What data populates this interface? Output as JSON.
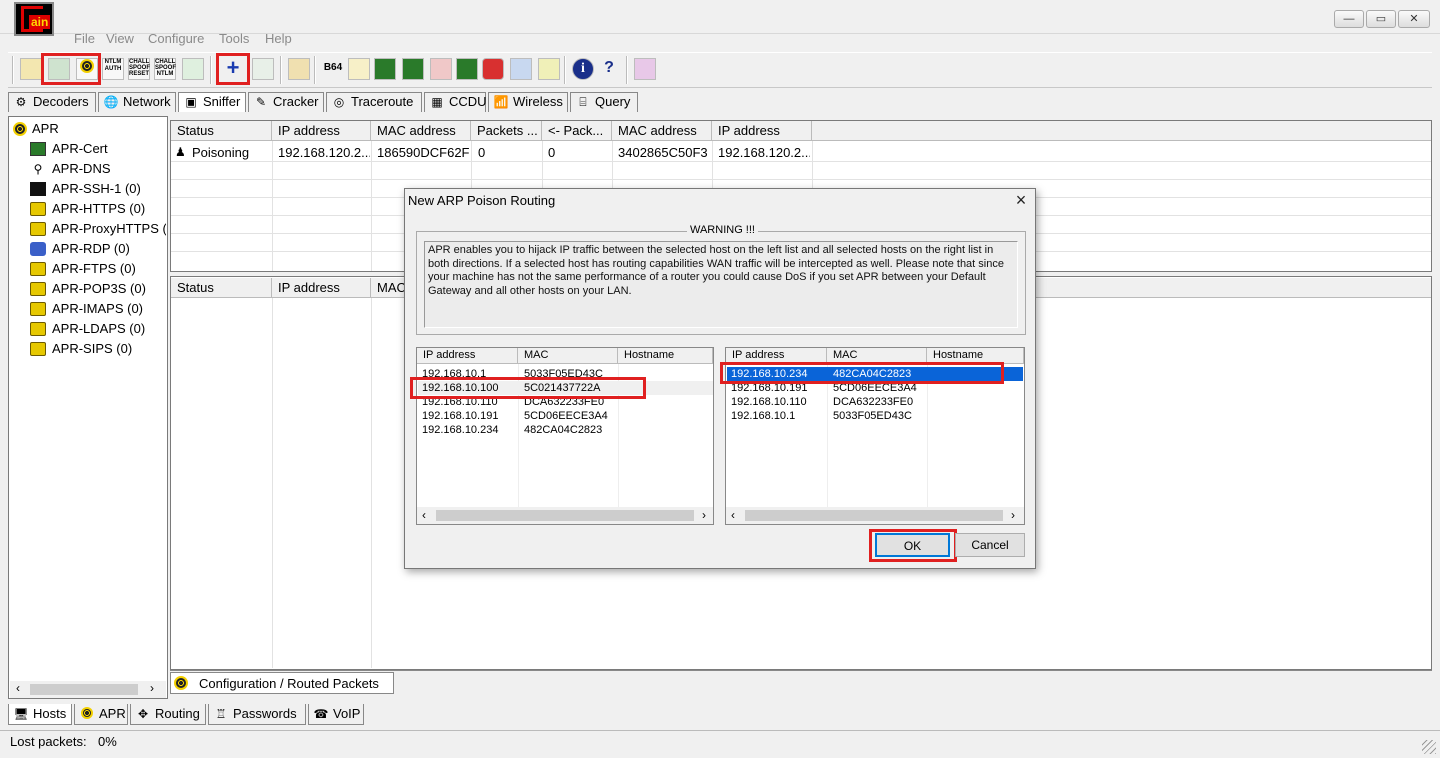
{
  "app": {
    "logo_text": "ain"
  },
  "window_controls": {
    "minimize": "—",
    "maximize": "▭",
    "close": "✕"
  },
  "menu": [
    "File",
    "View",
    "Configure",
    "Tools",
    "Help"
  ],
  "toolbar": {
    "ntlm_auth": "NTLM\nAUTH",
    "chall_spoof_reset": "CHALL\nSPOOF\nRESET",
    "chall_spoof_ntlm": "CHALL\nSPOOF\nNTLM",
    "b64": "B64",
    "add": "+",
    "info": "i",
    "help": "?"
  },
  "tabs": [
    "Decoders",
    "Network",
    "Sniffer",
    "Cracker",
    "Traceroute",
    "CCDU",
    "Wireless",
    "Query"
  ],
  "tree": {
    "root": "APR",
    "items": [
      "APR-Cert",
      "APR-DNS",
      "APR-SSH-1 (0)",
      "APR-HTTPS (0)",
      "APR-ProxyHTTPS (0",
      "APR-RDP (0)",
      "APR-FTPS (0)",
      "APR-POP3S (0)",
      "APR-IMAPS (0)",
      "APR-LDAPS (0)",
      "APR-SIPS (0)"
    ]
  },
  "upper_table": {
    "headers": [
      "Status",
      "IP address",
      "MAC address",
      "Packets ...",
      "<- Pack...",
      "MAC address",
      "IP address"
    ],
    "row": [
      "Poisoning",
      "192.168.120.2...",
      "186590DCF62F",
      "0",
      "0",
      "3402865C50F3",
      "192.168.120.2..."
    ]
  },
  "lower_table": {
    "headers": [
      "Status",
      "IP address",
      "MAC"
    ]
  },
  "bottom_pane_tab": "Configuration / Routed Packets",
  "dialog": {
    "title": "New ARP Poison Routing",
    "warning_title": "WARNING !!!",
    "warning_text": "APR enables you to hijack IP traffic between the selected host on the left list and all selected hosts on the right list in both directions. If a selected host has routing capabilities WAN traffic will be intercepted as well. Please note that since your machine has not the same performance of a router you could cause DoS if you set APR between your Default Gateway and all other hosts on your LAN.",
    "list_headers": [
      "IP address",
      "MAC",
      "Hostname"
    ],
    "left_rows": [
      [
        "192.168.10.1",
        "5033F05ED43C"
      ],
      [
        "192.168.10.100",
        "5C021437722A"
      ],
      [
        "192.168.10.110",
        "DCA632233FE0"
      ],
      [
        "192.168.10.191",
        "5CD06EECE3A4"
      ],
      [
        "192.168.10.234",
        "482CA04C2823"
      ]
    ],
    "right_rows": [
      [
        "192.168.10.234",
        "482CA04C2823"
      ],
      [
        "192.168.10.191",
        "5CD06EECE3A4"
      ],
      [
        "192.168.10.110",
        "DCA632233FE0"
      ],
      [
        "192.168.10.1",
        "5033F05ED43C"
      ]
    ],
    "ok": "OK",
    "cancel": "Cancel"
  },
  "bottom_tabs": [
    "Hosts",
    "APR",
    "Routing",
    "Passwords",
    "VoIP"
  ],
  "status": {
    "label": "Lost packets:",
    "value": "0%"
  }
}
